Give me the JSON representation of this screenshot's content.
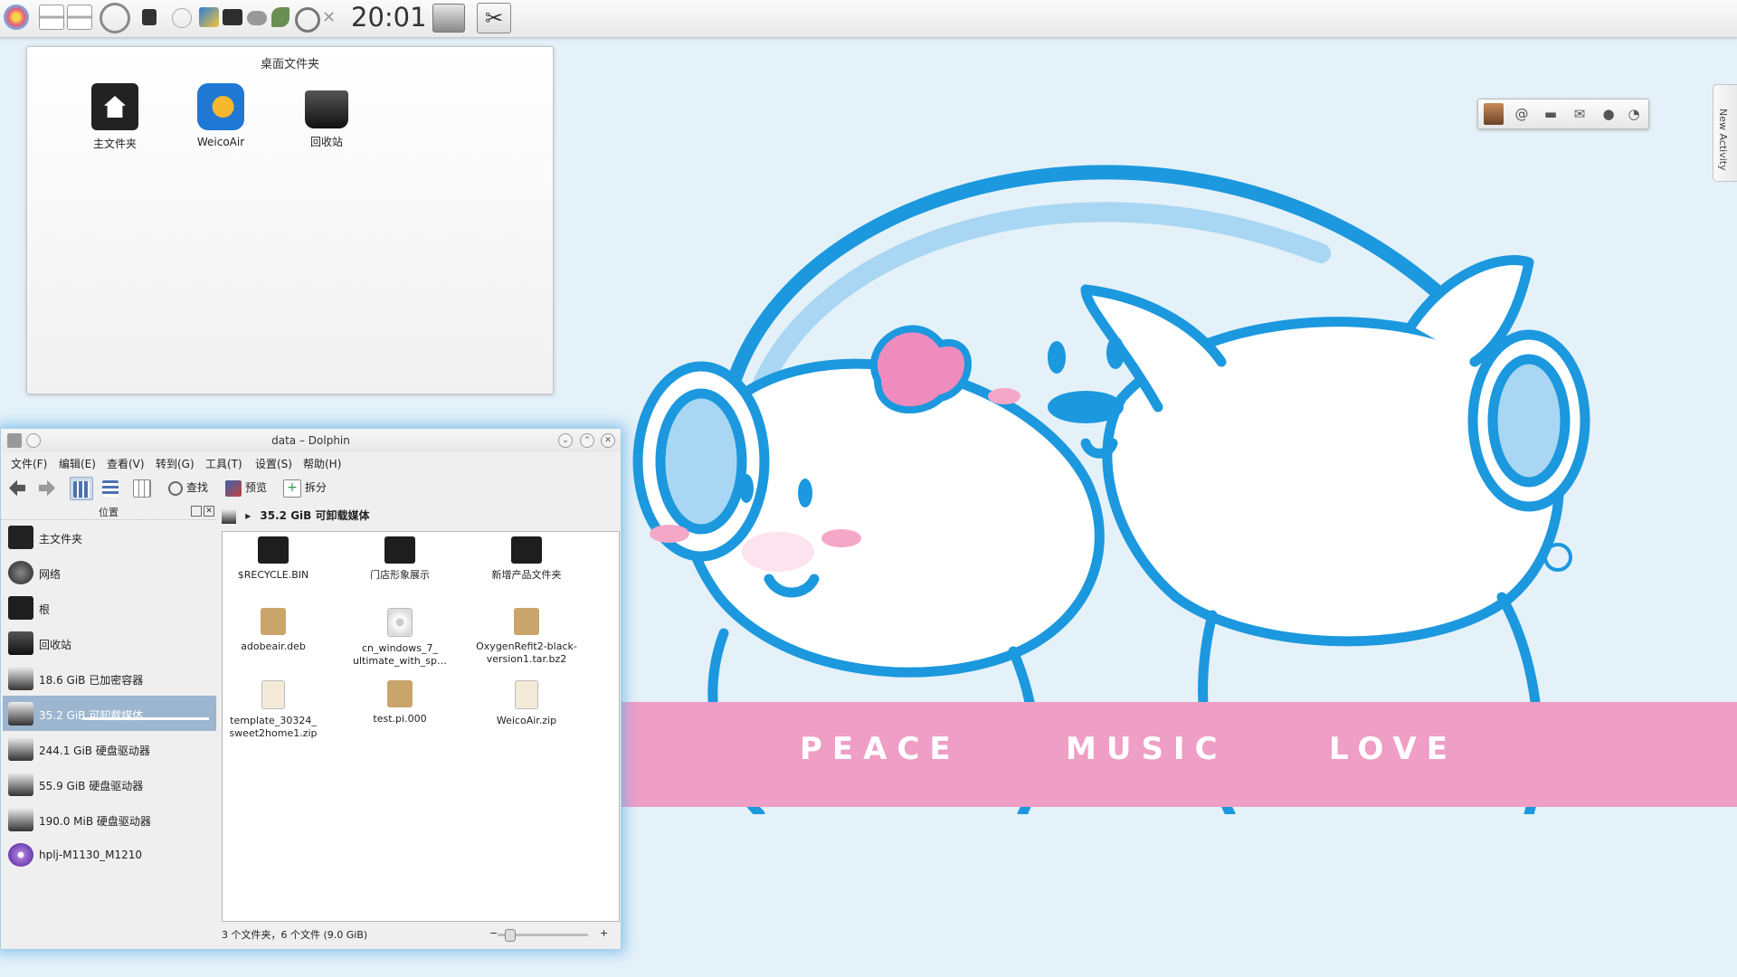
{
  "panel": {
    "clock": "20:01",
    "icons": [
      "kde-menu-icon",
      "pager-icon",
      "pager-icon-2",
      "browser-icon",
      "lock-icon",
      "info-icon",
      "weico-tray-icon",
      "monitor-icon",
      "network-icon",
      "music-icon",
      "headphones-icon",
      "close-x-icon",
      "disk-icon",
      "tools-icon"
    ]
  },
  "folderview": {
    "title": "桌面文件夹",
    "items": [
      {
        "label": "主文件夹",
        "icon": "home-folder-icon"
      },
      {
        "label": "WeicoAir",
        "icon": "weicoair-icon"
      },
      {
        "label": "回收站",
        "icon": "trash-icon"
      }
    ]
  },
  "social": {
    "tab_label": "New Activity",
    "icons": [
      "avatar-icon",
      "at-icon",
      "comment-icon",
      "mail-icon",
      "user-icon",
      "rss-icon"
    ]
  },
  "wallpaper": {
    "words": [
      "PEACE",
      "MUSIC",
      "LOVE"
    ],
    "banner_color": "#ef9ec6",
    "line_color": "#1c98de"
  },
  "dolphin": {
    "title": "data – Dolphin",
    "menu": [
      "文件(F)",
      "编辑(E)",
      "查看(V)",
      "转到(G)",
      "工具(T)",
      "设置(S)",
      "帮助(H)"
    ],
    "toolbar": {
      "find": "查找",
      "preview": "预览",
      "split": "拆分"
    },
    "places_title": "位置",
    "places": [
      {
        "label": "主文件夹",
        "icon": "home-icon"
      },
      {
        "label": "网络",
        "icon": "network-globe-icon"
      },
      {
        "label": "根",
        "icon": "folder-icon"
      },
      {
        "label": "回收站",
        "icon": "trash-icon"
      },
      {
        "label": "18.6 GiB 已加密容器",
        "icon": "drive-icon"
      },
      {
        "label": "35.2 GiB 可卸载媒体",
        "icon": "drive-icon"
      },
      {
        "label": "244.1 GiB 硬盘驱动器",
        "icon": "drive-icon"
      },
      {
        "label": "55.9 GiB 硬盘驱动器",
        "icon": "drive-icon"
      },
      {
        "label": "190.0 MiB 硬盘驱动器",
        "icon": "drive-icon"
      },
      {
        "label": "hplj-M1130_M1210",
        "icon": "media-icon"
      }
    ],
    "breadcrumb": "35.2 GiB 可卸载媒体",
    "files": [
      {
        "name": "$RECYCLE.BIN",
        "type": "folder"
      },
      {
        "name": "门店形象展示",
        "type": "folder"
      },
      {
        "name": "新增产品文件夹",
        "type": "folder"
      },
      {
        "name": "adobeair.deb",
        "type": "deb"
      },
      {
        "name": "cn_windows_7_ ultimate_with_sp…",
        "type": "iso"
      },
      {
        "name": "OxygenRefit2-black- version1.tar.bz2",
        "type": "tar"
      },
      {
        "name": "template_30324_ sweet2home1.zip",
        "type": "zip"
      },
      {
        "name": "test.pi.000",
        "type": "tar"
      },
      {
        "name": "WeicoAir.zip",
        "type": "zip"
      }
    ],
    "status": "3 个文件夹，6 个文件 (9.0 GiB)"
  }
}
